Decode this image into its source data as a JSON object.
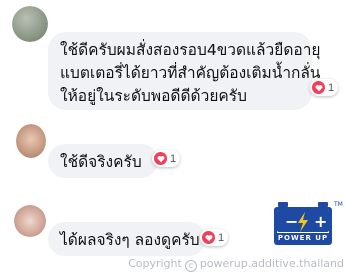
{
  "comments": [
    {
      "lines": [
        "ใช้ดีครับผมสั่งสองรอบ4ขวดแล้วยืดอายุ",
        "แบตเตอรี่ได้ยาวที่สำคัญต้องเติมน้ำกลั่น",
        "ให้อยู่ในระดับพอดีดีด้วยครับ"
      ],
      "reactions": "1"
    },
    {
      "lines": [
        "ใช้ดีจริงครับ"
      ],
      "reactions": "1"
    },
    {
      "lines": [
        "ได้ผลจริงๆ ลองดูครับ"
      ],
      "reactions": "1"
    }
  ],
  "logo": {
    "minus": "−",
    "plus": "+",
    "brand": "POWER UP",
    "trademark": "TM"
  },
  "watermark": {
    "prefix": "Copyright",
    "symbol": "c",
    "text": "powerup.additive.thailand"
  },
  "colors": {
    "bubble": "#f0f2f5",
    "heart": "#f33e58",
    "logo_blue": "#1f4aa3",
    "logo_yellow": "#f5c518"
  }
}
